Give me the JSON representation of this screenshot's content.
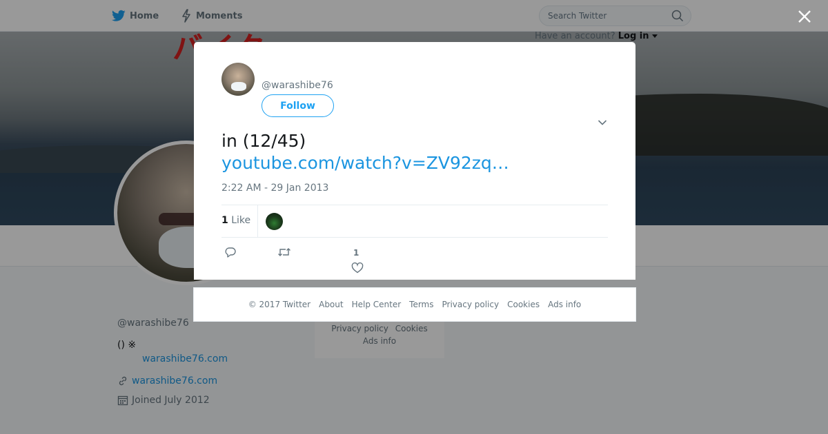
{
  "nav": {
    "home_label": "Home",
    "moments_label": "Moments",
    "search_placeholder": "Search Twitter",
    "login_prompt": "Have an account?",
    "login_label": "Log in"
  },
  "banner": {
    "text": "バイク"
  },
  "profile": {
    "name": "",
    "handle": "@warashibe76",
    "bio": "() ※",
    "bio_link": "warashibe76.com",
    "url": "warashibe76.com",
    "joined": "Joined July 2012"
  },
  "side_footer": {
    "items": [
      "Privacy policy",
      "Cookies",
      "Ads info"
    ]
  },
  "tweet": {
    "handle": "@warashibe76",
    "follow_label": "Follow",
    "text": " in (12/45)",
    "link": "youtube.com/watch?v=ZV92zq…",
    "timestamp": "2:22 AM - 29 Jan 2013",
    "likes_count": "1",
    "likes_label": "Like",
    "like_action_count": "1"
  },
  "footer": {
    "items": [
      "© 2017 Twitter",
      "About",
      "Help Center",
      "Terms",
      "Privacy policy",
      "Cookies",
      "Ads info"
    ]
  },
  "colors": {
    "brand": "#1da1f2",
    "link": "#1b95e0",
    "muted": "#66757f"
  },
  "icons": [
    "twitter-bird-icon",
    "lightning-icon",
    "search-icon",
    "close-icon",
    "chevron-down-icon",
    "reply-icon",
    "retweet-icon",
    "heart-icon",
    "link-icon",
    "calendar-icon"
  ]
}
